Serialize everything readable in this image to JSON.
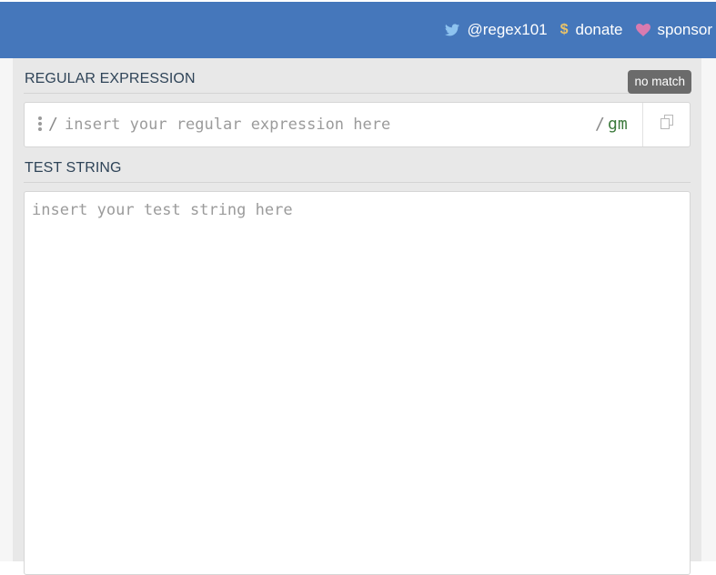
{
  "colors": {
    "brand": "#4577bb",
    "twitter": "#8ec3ef",
    "donate": "#e8c26a",
    "sponsor": "#d87bb0",
    "flags": "#3c7a3c"
  },
  "header": {
    "links": [
      {
        "icon": "twitter-icon",
        "label": "@regex101"
      },
      {
        "icon": "dollar-icon",
        "label": "donate"
      },
      {
        "icon": "heart-icon",
        "label": "sponsor"
      }
    ]
  },
  "regex": {
    "title": "REGULAR EXPRESSION",
    "status": "no match",
    "open_delimiter": "/",
    "close_delimiter": "/",
    "placeholder": "insert your regular expression here",
    "value": "",
    "flags": "gm"
  },
  "test": {
    "title": "TEST STRING",
    "placeholder": "insert your test string here",
    "value": ""
  }
}
